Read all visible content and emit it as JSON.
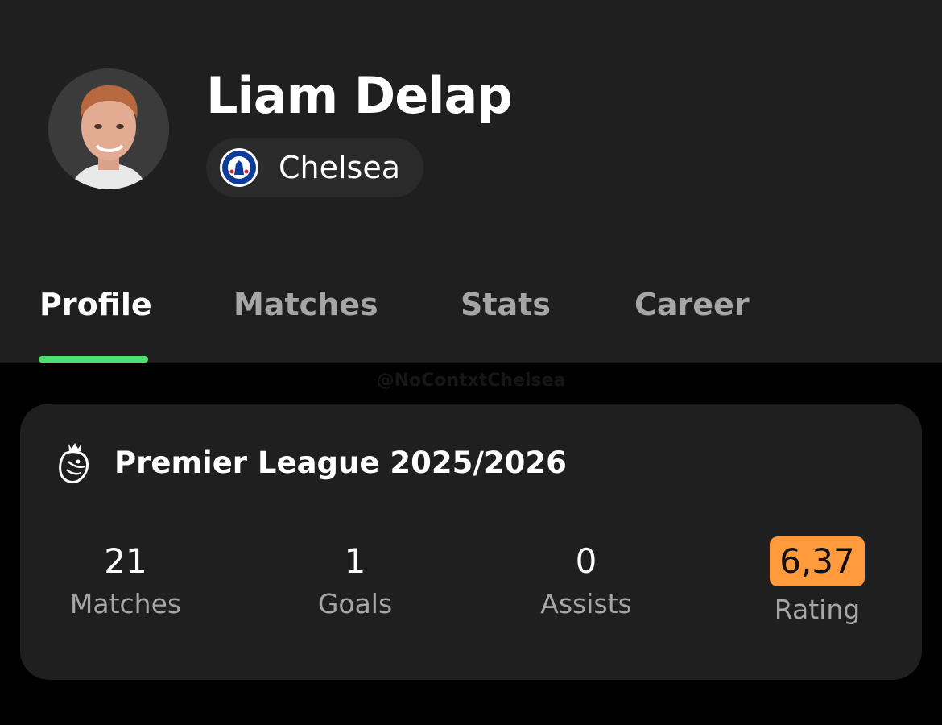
{
  "player": {
    "name": "Liam Delap",
    "team": "Chelsea"
  },
  "tabs": [
    {
      "label": "Profile",
      "active": true
    },
    {
      "label": "Matches",
      "active": false
    },
    {
      "label": "Stats",
      "active": false
    },
    {
      "label": "Career",
      "active": false
    }
  ],
  "watermark": "@NoContxtChelsea",
  "season_card": {
    "league_icon": "premier-league-lion-icon",
    "title": "Premier League 2025/2026",
    "stats": [
      {
        "value": "21",
        "label": "Matches"
      },
      {
        "value": "1",
        "label": "Goals"
      },
      {
        "value": "0",
        "label": "Assists"
      },
      {
        "value": "6,37",
        "label": "Rating"
      }
    ]
  },
  "colors": {
    "background": "#000000",
    "panel": "#1f1f1f",
    "chip": "#2a2a2a",
    "active_tab_indicator": "#4ee06b",
    "rating_badge": "#ff9b3d",
    "muted_text": "#a6a6a6"
  }
}
